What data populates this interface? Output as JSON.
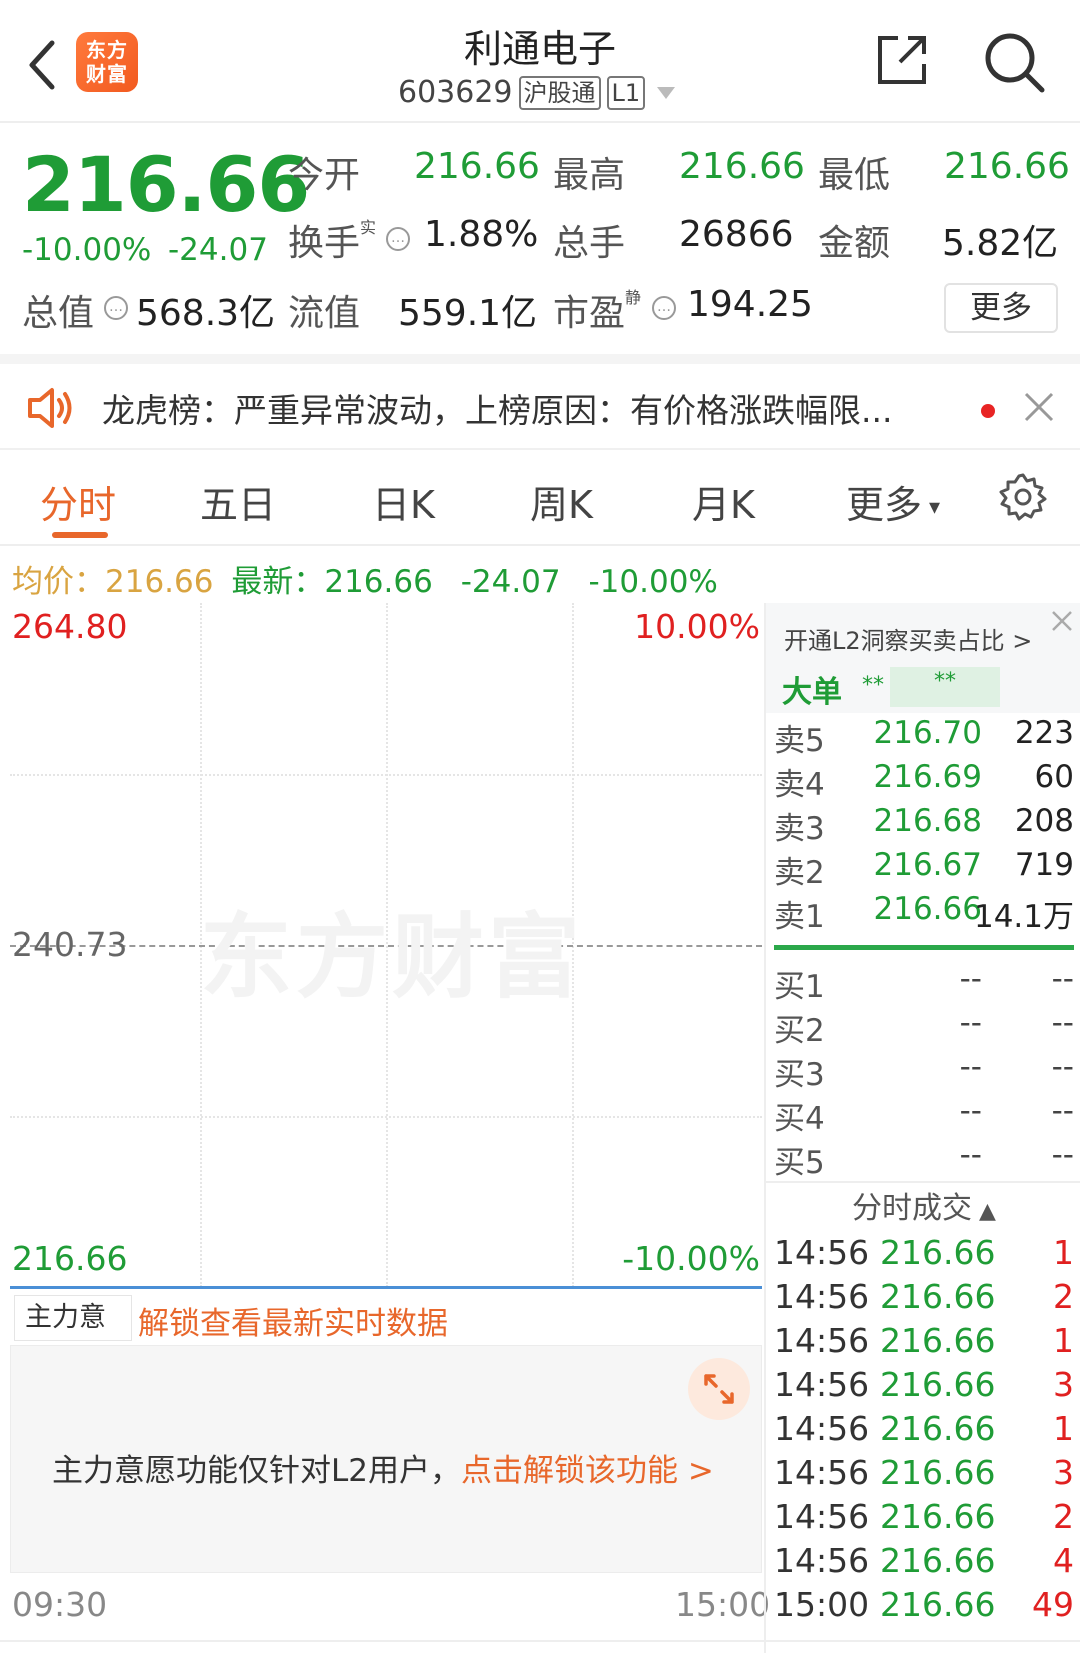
{
  "header": {
    "logo_line1": "东方",
    "logo_line2": "财富",
    "stock_name": "利通电子",
    "stock_code": "603629",
    "tag_connect": "沪股通",
    "tag_level": "L1"
  },
  "quote": {
    "price": "216.66",
    "change_pct": "-10.00%",
    "change_amt": "-24.07",
    "open_label": "今开",
    "open_value": "216.66",
    "high_label": "最高",
    "high_value": "216.66",
    "low_label": "最低",
    "low_value": "216.66",
    "turnover_label": "换手",
    "turnover_sup": "实",
    "turnover_value": "1.88%",
    "volume_label": "总手",
    "volume_value": "26866",
    "amount_label": "金额",
    "amount_value": "5.82亿",
    "mktcap_label": "总值",
    "mktcap_value": "568.3亿",
    "float_label": "流值",
    "float_value": "559.1亿",
    "pe_label": "市盈",
    "pe_sup": "静",
    "pe_value": "194.25",
    "more_label": "更多"
  },
  "notice": {
    "text": "龙虎榜：严重异常波动，上榜原因：有价格涨跌幅限..."
  },
  "tabs": [
    "分时",
    "五日",
    "日K",
    "周K",
    "月K",
    "更多"
  ],
  "avg_bar": {
    "avg_label": "均价：",
    "avg_value": "216.66",
    "latest_label": "最新：",
    "latest_value": "216.66",
    "change_amt": "-24.07",
    "change_pct": "-10.00%"
  },
  "chart": {
    "y_top": "264.80",
    "y_mid": "240.73",
    "y_bottom": "216.66",
    "pct_top": "10.00%",
    "pct_bottom": "-10.00%",
    "watermark": "东方财富",
    "time_start": "09:30",
    "time_end": "15:00",
    "colors": {
      "up": "#e02020",
      "down": "#1f9c36",
      "price_line": "#4a8fd6"
    }
  },
  "main_force": {
    "select_label": "主力意愿",
    "unlock_label": "解锁查看最新实时数据",
    "message": "主力意愿功能仅针对L2用户，",
    "message_link": "点击解锁该功能 >"
  },
  "order_book": {
    "l2_title": "开通L2洞察买卖占比 >",
    "big_order_label": "大单",
    "big_order_stars_1": "**",
    "big_order_stars_2": "**",
    "sells": [
      {
        "name": "卖5",
        "price": "216.70",
        "vol": "223"
      },
      {
        "name": "卖4",
        "price": "216.69",
        "vol": "60"
      },
      {
        "name": "卖3",
        "price": "216.68",
        "vol": "208"
      },
      {
        "name": "卖2",
        "price": "216.67",
        "vol": "719"
      },
      {
        "name": "卖1",
        "price": "216.66",
        "vol": "14.1万"
      }
    ],
    "buys": [
      {
        "name": "买1",
        "price": "--",
        "vol": "--"
      },
      {
        "name": "买2",
        "price": "--",
        "vol": "--"
      },
      {
        "name": "买3",
        "price": "--",
        "vol": "--"
      },
      {
        "name": "买4",
        "price": "--",
        "vol": "--"
      },
      {
        "name": "买5",
        "price": "--",
        "vol": "--"
      }
    ]
  },
  "trades": {
    "title": "分时成交",
    "rows": [
      {
        "time": "14:56",
        "price": "216.66",
        "vol": "1"
      },
      {
        "time": "14:56",
        "price": "216.66",
        "vol": "2"
      },
      {
        "time": "14:56",
        "price": "216.66",
        "vol": "1"
      },
      {
        "time": "14:56",
        "price": "216.66",
        "vol": "3"
      },
      {
        "time": "14:56",
        "price": "216.66",
        "vol": "1"
      },
      {
        "time": "14:56",
        "price": "216.66",
        "vol": "3"
      },
      {
        "time": "14:56",
        "price": "216.66",
        "vol": "2"
      },
      {
        "time": "14:56",
        "price": "216.66",
        "vol": "4"
      },
      {
        "time": "15:00",
        "price": "216.66",
        "vol": "49"
      }
    ]
  }
}
